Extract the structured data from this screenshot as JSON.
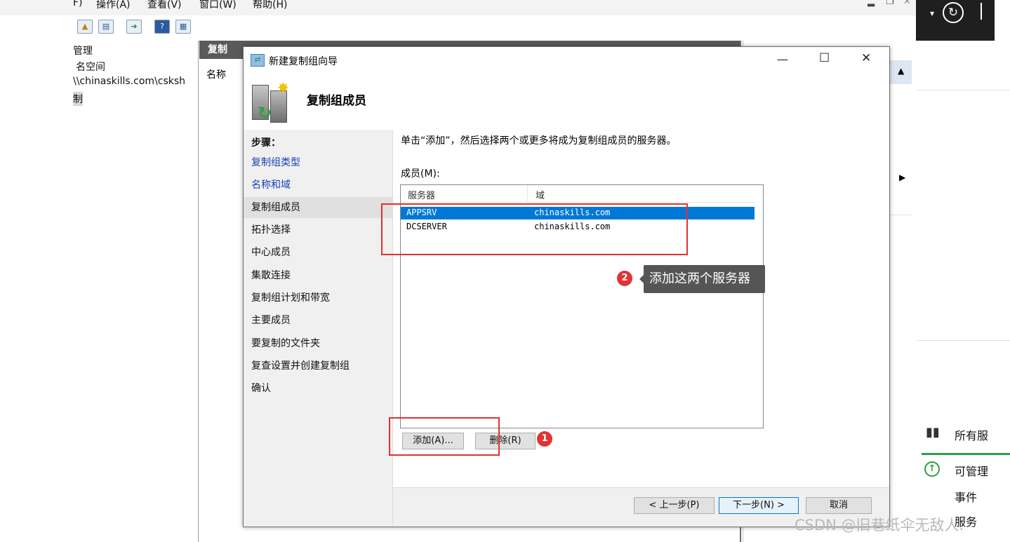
{
  "mmc": {
    "menu": [
      "F)",
      "操作(A)",
      "查看(V)",
      "窗口(W)",
      "帮助(H)"
    ],
    "tree": [
      "管理",
      "名空间",
      "\\\\chinaskills.com\\csksh",
      "制"
    ],
    "middle_header": "复制",
    "middle_column": "名称"
  },
  "dialog": {
    "title": "新建复制组向导",
    "header_title": "复制组成员",
    "steps_label": "步骤：",
    "steps": [
      {
        "label": "复制组类型",
        "state": "link"
      },
      {
        "label": "名称和域",
        "state": "link"
      },
      {
        "label": "复制组成员",
        "state": "current"
      },
      {
        "label": "拓扑选择",
        "state": "normal"
      },
      {
        "label": "中心成员",
        "state": "normal"
      },
      {
        "label": "集散连接",
        "state": "normal"
      },
      {
        "label": "复制组计划和带宽",
        "state": "normal"
      },
      {
        "label": "主要成员",
        "state": "normal"
      },
      {
        "label": "要复制的文件夹",
        "state": "normal"
      },
      {
        "label": "复查设置并创建复制组",
        "state": "normal"
      },
      {
        "label": "确认",
        "state": "normal"
      }
    ],
    "instruction": "单击“添加”，然后选择两个或更多将成为复制组成员的服务器。",
    "members_label": "成员(M):",
    "columns": [
      "服务器",
      "域"
    ],
    "rows": [
      {
        "server": "APPSRV",
        "domain": "chinaskills.com",
        "selected": true
      },
      {
        "server": "DCSERVER",
        "domain": "chinaskills.com",
        "selected": false
      }
    ],
    "add_button": "添加(A)...",
    "remove_button": "删除(R)",
    "back_button": "< 上一步(P)",
    "next_button": "下一步(N) >",
    "cancel_button": "取消",
    "window_controls": [
      "—",
      "☐",
      "✕"
    ]
  },
  "annotations": {
    "badge1": "1",
    "badge2": "2",
    "tooltip": "添加这两个服务器",
    "accent": "#e03131"
  },
  "server_manager": {
    "title_short": "所有服",
    "items": [
      "可管理",
      "事件",
      "服务"
    ]
  },
  "watermark": "CSDN @旧巷纸伞无敌人."
}
